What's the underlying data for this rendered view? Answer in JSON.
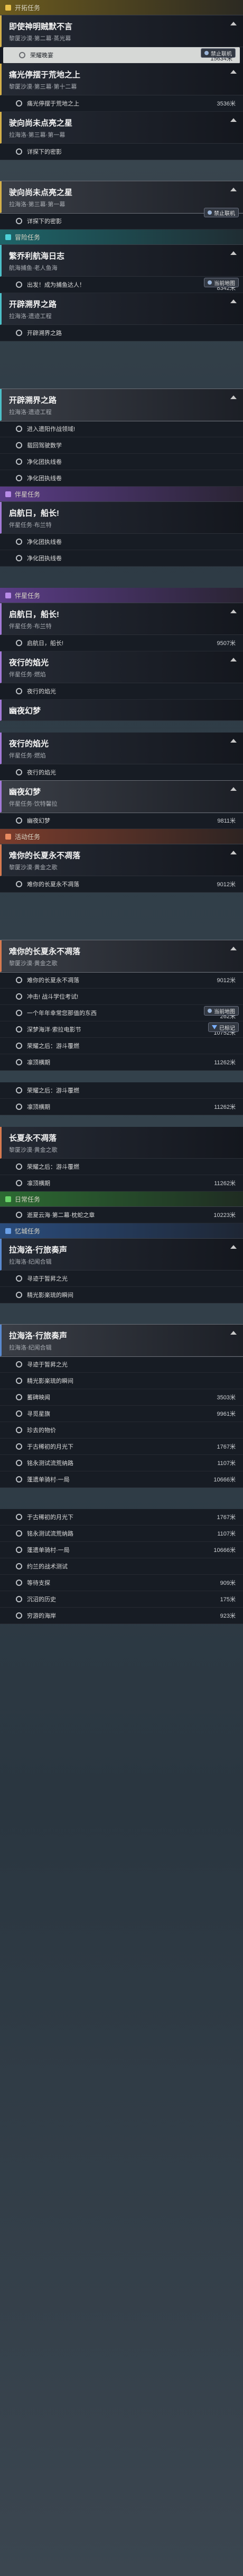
{
  "sections": {
    "trailblaze": "开拓任务",
    "adventure": "冒险任务",
    "companion": "伴星任务",
    "event": "活动任务",
    "daily": "日常任务",
    "memory": "忆城任务"
  },
  "badges": {
    "no_contact": "禁止联机",
    "in_map": "当前地图",
    "mark": "已标记"
  },
  "icons": {
    "section": "diamond-icon",
    "step": "ring-icon",
    "collapse": "chevron-up-icon",
    "badge": "gamepad-icon",
    "mark": "pin-icon"
  },
  "quests": [
    {
      "title": "即使神明贼默不言",
      "sub": "黎厦沙漠·第二幕·蒸光幕",
      "steps": [
        {
          "name": "荣耀晚宴",
          "dist": "15634米"
        }
      ]
    },
    {
      "title": "痛光停摆于荒地之上",
      "sub": "黎厦沙漠·第三幕·第十二幕",
      "steps": [
        {
          "name": "痛光停摆于荒地之上",
          "dist": "3536米"
        }
      ]
    },
    {
      "title": "驶向尚未点亮之星",
      "sub": "拉海洛·第三幕·第一幕",
      "steps": [
        {
          "name": "详探下的密影",
          "dist": ""
        }
      ]
    },
    {
      "title": "驶向尚未点亮之星",
      "sub": "拉海洛·第三幕·第一幕",
      "steps": [
        {
          "name": "详探下的密影",
          "dist": ""
        }
      ]
    },
    {
      "title": "繁乔利航海日志",
      "sub": "航海捕鱼·老人鱼海",
      "steps": [
        {
          "name": "出发！成为捕鱼达人！",
          "dist": "8342米"
        }
      ]
    },
    {
      "title": "开辟溯界之路",
      "sub": "拉海洛·遗迹工程",
      "steps": [
        {
          "name": "开辟溯界之路",
          "dist": ""
        }
      ]
    },
    {
      "title": "开辟溯界之路",
      "sub": "拉海洛·遗迹工程",
      "steps": [
        {
          "name": "进入遗阳作战领域!",
          "dist": ""
        },
        {
          "name": "载回驾驶数学",
          "dist": ""
        },
        {
          "name": "净化团执线卷",
          "dist": ""
        },
        {
          "name": "净化团执线卷",
          "dist": ""
        }
      ]
    },
    {
      "title": "启航日，船长!",
      "sub": "伴星任务·布兰特",
      "steps": [
        {
          "name": "净化团执线卷",
          "dist": ""
        },
        {
          "name": "净化团执线卷",
          "dist": ""
        }
      ]
    },
    {
      "title": "启航日，船长!",
      "sub": "伴星任务·布兰特",
      "steps": [
        {
          "name": "启航日，船长!",
          "dist": "9507米"
        }
      ]
    },
    {
      "title": "夜行的焰光",
      "sub": "伴星任务·燃焰",
      "steps": [
        {
          "name": "夜行的焰光",
          "dist": ""
        }
      ]
    },
    {
      "title": "幽夜幻梦",
      "sub": "",
      "steps": []
    },
    {
      "title": "夜行的焰光",
      "sub": "伴星任务·燃焰",
      "steps": [
        {
          "name": "夜行的焰光",
          "dist": ""
        }
      ]
    },
    {
      "title": "幽夜幻梦",
      "sub": "伴星任务·饮特馨拉",
      "steps": [
        {
          "name": "幽夜幻梦",
          "dist": "9811米"
        }
      ]
    },
    {
      "title": "难你的长夏永不凋落",
      "sub": "黎厦沙漠·黄金之歌",
      "steps": [
        {
          "name": "难你的长夏永不凋落",
          "dist": "9012米"
        }
      ]
    },
    {
      "title": "难你的长夏永不凋落",
      "sub": "黎厦沙漠·黄金之歌",
      "steps": [
        {
          "name": "难你的长夏永不凋落",
          "dist": "9012米"
        },
        {
          "name": "冲击! 战斗学位考试!",
          "dist": ""
        },
        {
          "name": "一个年年幸常您那值的东西",
          "dist": "262米"
        },
        {
          "name": "深梦海洋·索拉电影节",
          "dist": "10752米"
        },
        {
          "name": "荣耀之后：游斗覆燃",
          "dist": ""
        },
        {
          "name": "凛顶横期",
          "dist": "11262米"
        }
      ]
    },
    {
      "title": "荣耀之后：游斗覆燃",
      "sub": "",
      "steps": [
        {
          "name": "凛顶横期",
          "dist": "11262米"
        }
      ]
    },
    {
      "title": "长夏永不凋落",
      "sub": "黎厦沙漠·黄金之歌",
      "steps": [
        {
          "name": "荣耀之后：游斗覆燃",
          "dist": ""
        },
        {
          "name": "凛顶横期",
          "dist": "11262米"
        },
        {
          "name": "逝夏云海·第二幕·枕蛇之章",
          "dist": "10223米"
        }
      ]
    },
    {
      "title": "拉海洛·行旅奏声",
      "sub": "拉海洛·纪闻合辑",
      "steps": [
        {
          "name": "寻迹于暂昇之光",
          "dist": ""
        },
        {
          "name": "精光影楽琉的瞬间",
          "dist": ""
        }
      ]
    },
    {
      "title": "拉海洛·行旅奏声",
      "sub": "拉海洛·纪闻合辑",
      "steps": [
        {
          "name": "寻迹于暂昇之光",
          "dist": ""
        },
        {
          "name": "精光影楽琉的瞬间",
          "dist": ""
        },
        {
          "name": "蓄碑映闻",
          "dist": "3503米"
        },
        {
          "name": "寻觅星旗",
          "dist": "9961米"
        },
        {
          "name": "珍去的物价",
          "dist": ""
        },
        {
          "name": "于古稀初的月光下",
          "dist": "1767米"
        },
        {
          "name": "铭永测试流荒纳路",
          "dist": "1107米"
        },
        {
          "name": "蓬遗单骑村·一局",
          "dist": "10666米"
        }
      ]
    },
    {
      "title": "行旅奏声",
      "sub": "",
      "steps": [
        {
          "name": "于古稀初的月光下",
          "dist": "1767米"
        },
        {
          "name": "铭永测试流荒纳路",
          "dist": "1107米"
        },
        {
          "name": "蓬遗单骑村·一局",
          "dist": "10666米"
        },
        {
          "name": "约兰的战术测试",
          "dist": ""
        },
        {
          "name": "等待支探",
          "dist": "909米"
        },
        {
          "name": "沉沼的历史",
          "dist": "175米"
        },
        {
          "name": "穷游的海岸",
          "dist": "923米"
        }
      ]
    }
  ]
}
